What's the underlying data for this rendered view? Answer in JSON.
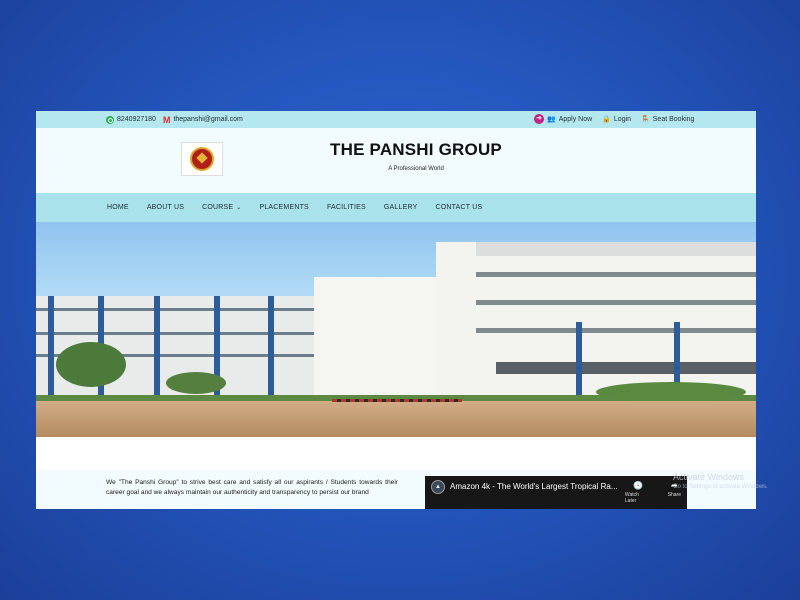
{
  "topbar": {
    "phone": "8240927180",
    "email": "thepanshi@gmail.com",
    "links": [
      {
        "label": "Apply Now",
        "icon": "arrow-circle-icon"
      },
      {
        "label": "Login",
        "icon": "lock-icon"
      },
      {
        "label": "Seat Booking",
        "icon": "seat-icon"
      }
    ]
  },
  "header": {
    "title": "THE PANSHI GROUP",
    "tagline": "A Professional World"
  },
  "nav": {
    "items": [
      {
        "label": "HOME"
      },
      {
        "label": "ABOUT US"
      },
      {
        "label": "COURSE",
        "has_dropdown": true
      },
      {
        "label": "PLACEMENTS"
      },
      {
        "label": "FACILITIES"
      },
      {
        "label": "GALLERY"
      },
      {
        "label": "CONTACT US"
      }
    ]
  },
  "about": {
    "text": "We \"The Panshi Group\" to strive best care and satisfy all our aspirants / Students towards their career goal and we always maintain our authenticity and transparency to persist our brand"
  },
  "video": {
    "title": "Amazon 4k - The World's Largest Tropical Ra...",
    "watch_later": "Watch Later",
    "share": "Share"
  },
  "watermark": {
    "title": "Activate Windows",
    "subtitle": "Go to Settings to activate Windows."
  },
  "colors": {
    "background": "#2457be",
    "topbar": "#b5e7ee",
    "nav": "#a9e2ea",
    "page": "#f2fbfd"
  }
}
